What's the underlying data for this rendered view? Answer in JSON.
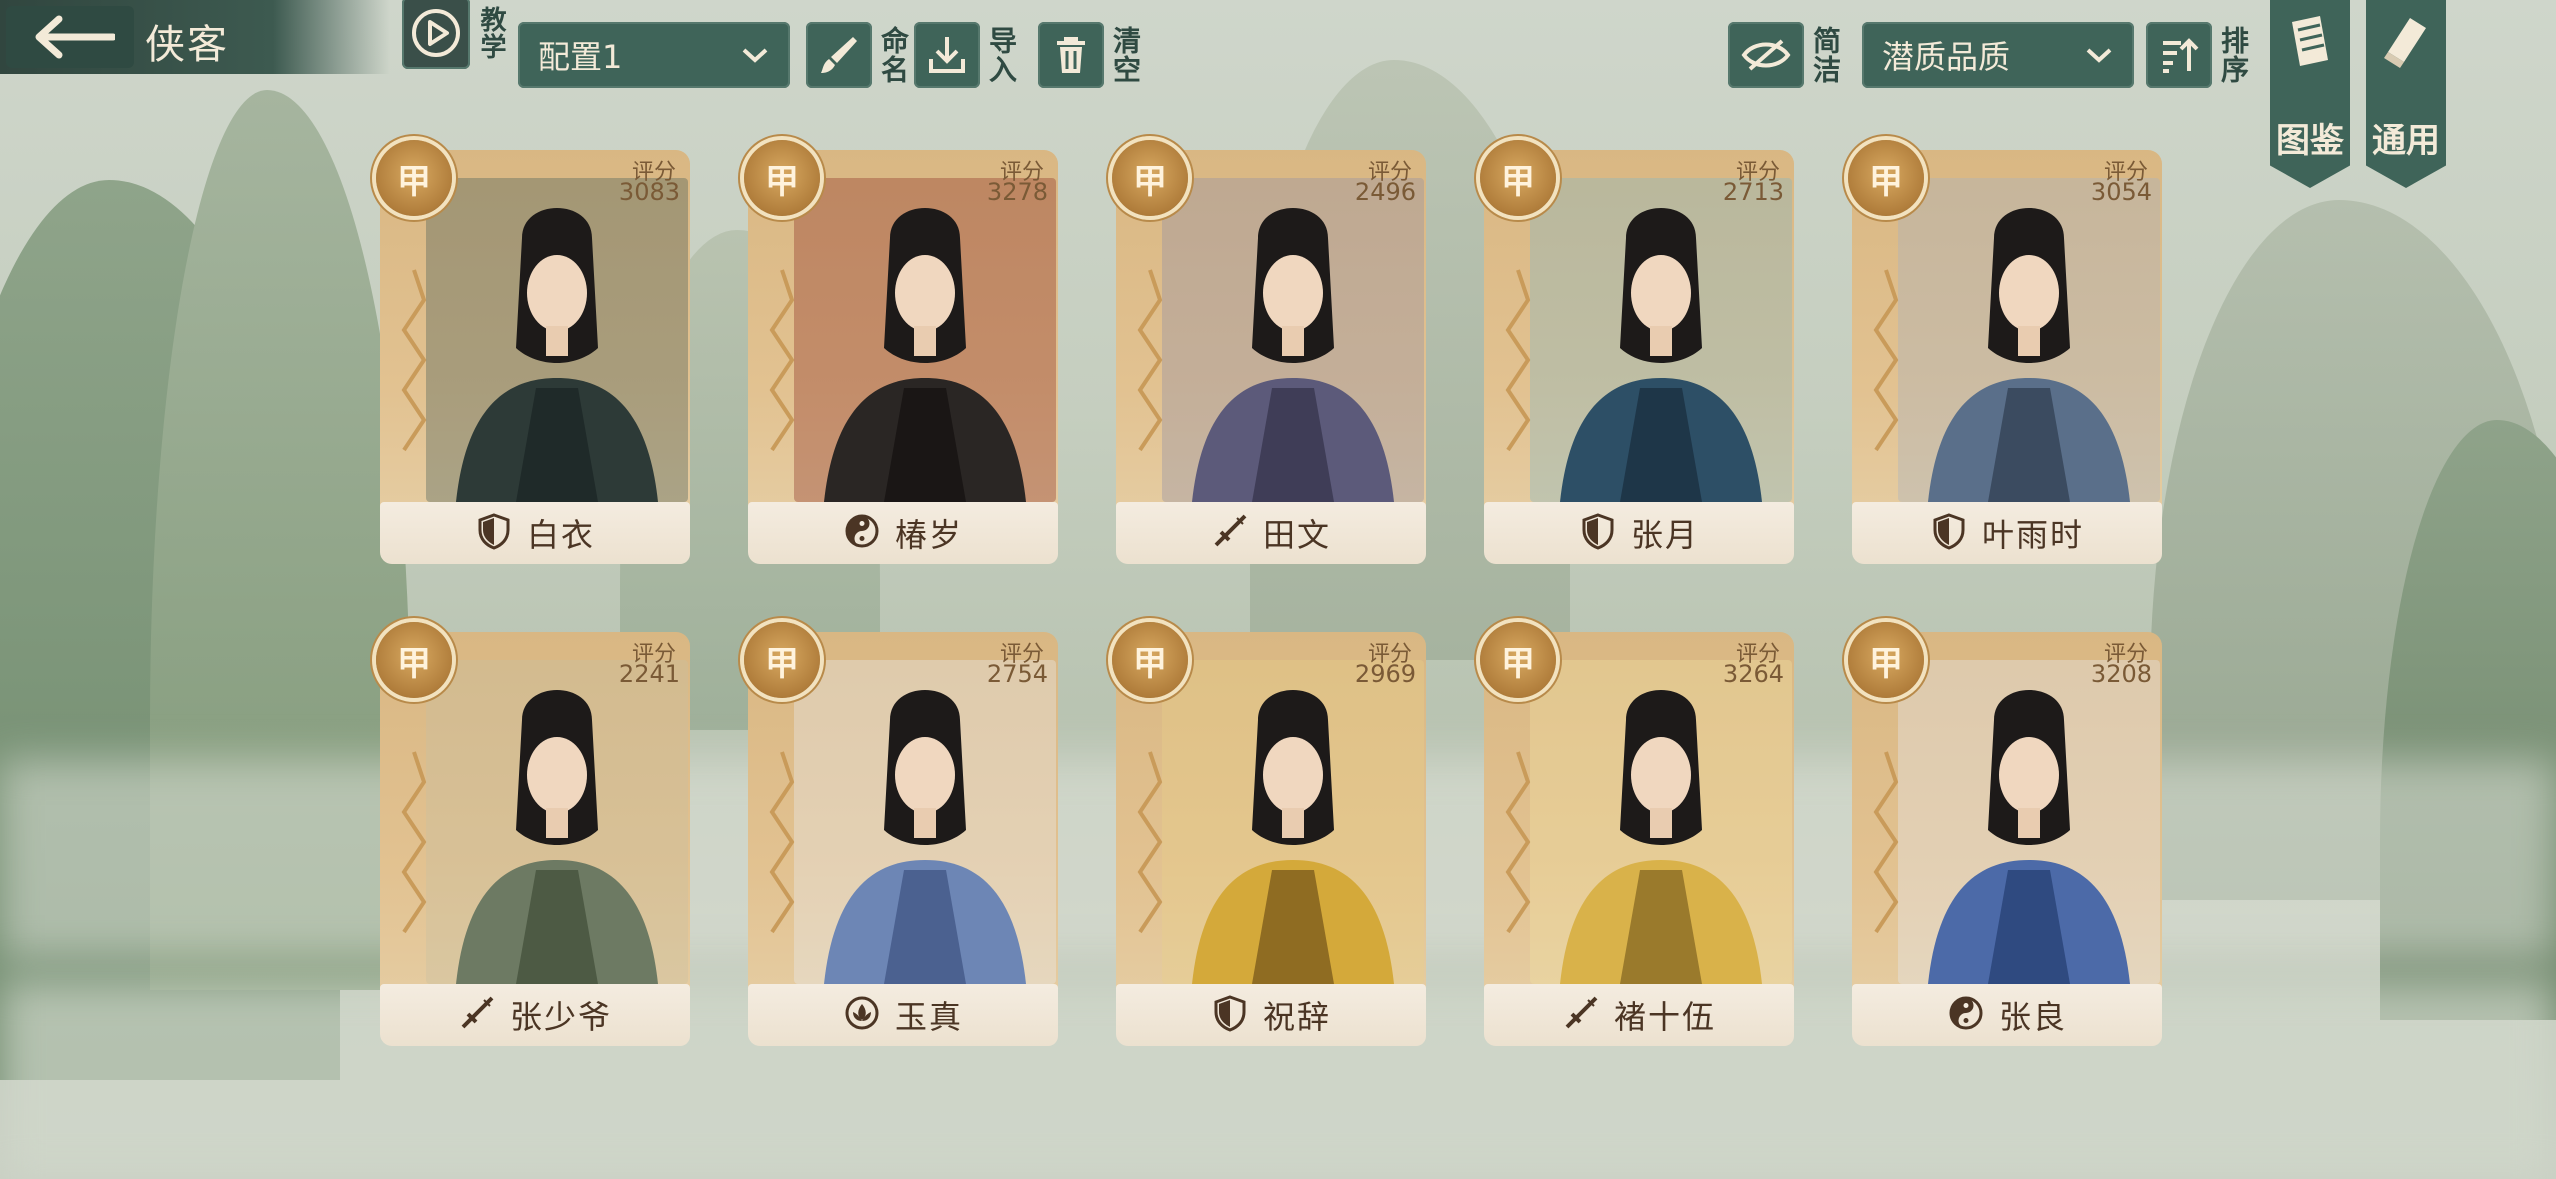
{
  "header": {
    "title": "侠客",
    "tutorial_label": "教学",
    "config_select": "配置1",
    "rename_label": "命名",
    "import_label": "导入",
    "clear_label": "清空",
    "simple_label": "简洁",
    "sort_select": "潜质品质",
    "sort_label": "排序"
  },
  "banners": {
    "codex_label": "图鉴",
    "general_label": "通用"
  },
  "score_label": "评分",
  "cards": [
    {
      "name": "白衣",
      "grade": "甲",
      "score": "3083",
      "role": "shield"
    },
    {
      "name": "椿岁",
      "grade": "甲",
      "score": "3278",
      "role": "yinyang"
    },
    {
      "name": "田文",
      "grade": "甲",
      "score": "2496",
      "role": "sword"
    },
    {
      "name": "张月",
      "grade": "甲",
      "score": "2713",
      "role": "shield"
    },
    {
      "name": "叶雨时",
      "grade": "甲",
      "score": "3054",
      "role": "shield"
    },
    {
      "name": "张少爷",
      "grade": "甲",
      "score": "2241",
      "role": "sword"
    },
    {
      "name": "玉真",
      "grade": "甲",
      "score": "2754",
      "role": "lotus"
    },
    {
      "name": "祝辞",
      "grade": "甲",
      "score": "2969",
      "role": "shield"
    },
    {
      "name": "褚十伍",
      "grade": "甲",
      "score": "3264",
      "role": "sword"
    },
    {
      "name": "张良",
      "grade": "甲",
      "score": "3208",
      "role": "yinyang"
    }
  ],
  "colors": {
    "panel": "#3f6459",
    "card": "#e2c291",
    "grade_badge": "#b07d3b",
    "name_text": "#4b3524"
  }
}
